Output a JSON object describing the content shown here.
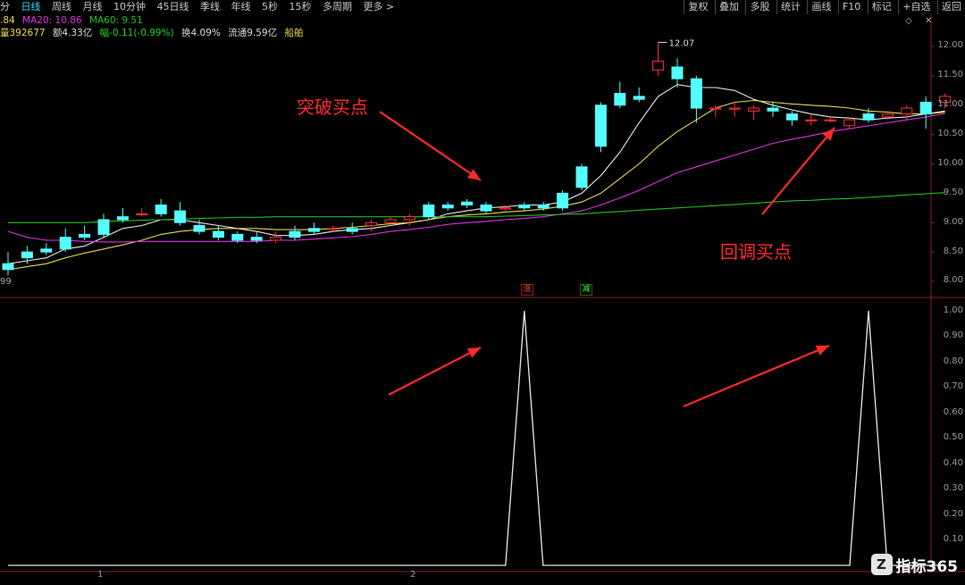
{
  "toolbar": {
    "left_fragment": "分",
    "periods": [
      "日线",
      "周线",
      "月线",
      "10分钟",
      "45日线",
      "季线",
      "年线",
      "5秒",
      "15秒",
      "多周期",
      "更多 >"
    ],
    "active_period": "日线",
    "right_tools": [
      "复权",
      "叠加",
      "多股",
      "统计",
      "画线",
      "F10",
      "标记",
      "+自选",
      "返回"
    ]
  },
  "ma_line": {
    "ma5": ".84",
    "ma20": "MA20: 10.86",
    "ma60": "MA60: 9.51"
  },
  "info_line": {
    "vol": "量392677",
    "amount": "额4.33亿",
    "change": "幅-0.11(-0.99%)",
    "turnover": "换4.09%",
    "float": "流通9.59亿",
    "sector": "船舶"
  },
  "price_axis": [
    "12.00",
    "11.50",
    "11.00",
    "10.50",
    "10.00",
    "9.50",
    "9.00",
    "8.50",
    "8.00"
  ],
  "indicator_axis": [
    "1.00",
    "0.90",
    "0.80",
    "0.70",
    "0.60",
    "0.50",
    "0.40",
    "0.30",
    "0.20",
    "0.10"
  ],
  "high_label": "12.07",
  "left_edge_fragment": "99",
  "markers": {
    "up": "涨",
    "down": "减"
  },
  "annotations": {
    "breakout": "突破买点",
    "pullback": "回调买点"
  },
  "time_axis_labels": [
    "1",
    "2"
  ],
  "colors": {
    "up": "#ff3030",
    "down": "#54ffff",
    "ma5": "#e8e8e8",
    "ma10": "#e6d84a",
    "ma20": "#e030e0",
    "ma60": "#1fbf1f",
    "annotation": "#ff2a2a"
  },
  "logo": {
    "icon": "Z",
    "text": "指标365"
  },
  "chart_data": {
    "type": "candlestick",
    "ylim": [
      7.9,
      12.2
    ],
    "candles": [
      [
        8.3,
        8.2,
        8.5,
        8.1
      ],
      [
        8.5,
        8.4,
        8.6,
        8.3
      ],
      [
        8.55,
        8.5,
        8.65,
        8.45
      ],
      [
        8.75,
        8.55,
        8.9,
        8.5
      ],
      [
        8.8,
        8.75,
        8.95,
        8.7
      ],
      [
        9.05,
        8.8,
        9.15,
        8.75
      ],
      [
        9.1,
        9.05,
        9.25,
        9.0
      ],
      [
        9.15,
        9.15,
        9.25,
        9.1
      ],
      [
        9.3,
        9.15,
        9.4,
        9.1
      ],
      [
        9.2,
        9.0,
        9.35,
        8.95
      ],
      [
        8.95,
        8.85,
        9.05,
        8.8
      ],
      [
        8.85,
        8.75,
        8.95,
        8.7
      ],
      [
        8.8,
        8.7,
        8.85,
        8.65
      ],
      [
        8.75,
        8.7,
        8.85,
        8.65
      ],
      [
        8.7,
        8.75,
        8.85,
        8.65
      ],
      [
        8.85,
        8.75,
        8.95,
        8.7
      ],
      [
        8.9,
        8.85,
        9.0,
        8.8
      ],
      [
        8.9,
        8.9,
        8.95,
        8.85
      ],
      [
        8.9,
        8.85,
        9.0,
        8.8
      ],
      [
        8.95,
        9.0,
        9.05,
        8.85
      ],
      [
        9.0,
        9.05,
        9.1,
        8.95
      ],
      [
        9.05,
        9.1,
        9.15,
        8.95
      ],
      [
        9.3,
        9.1,
        9.35,
        9.05
      ],
      [
        9.3,
        9.25,
        9.35,
        9.2
      ],
      [
        9.35,
        9.3,
        9.4,
        9.25
      ],
      [
        9.3,
        9.2,
        9.35,
        9.15
      ],
      [
        9.25,
        9.25,
        9.3,
        9.2
      ],
      [
        9.3,
        9.25,
        9.35,
        9.2
      ],
      [
        9.3,
        9.25,
        9.35,
        9.2
      ],
      [
        9.5,
        9.25,
        9.55,
        9.2
      ],
      [
        9.95,
        9.6,
        10.0,
        9.55
      ],
      [
        11.0,
        10.3,
        11.05,
        10.2
      ],
      [
        11.2,
        11.0,
        11.4,
        10.95
      ],
      [
        11.15,
        11.1,
        11.3,
        11.05
      ],
      [
        11.6,
        11.75,
        12.07,
        11.5
      ],
      [
        11.65,
        11.45,
        11.8,
        11.3
      ],
      [
        11.45,
        10.95,
        11.5,
        10.7
      ],
      [
        10.95,
        10.95,
        11.0,
        10.8
      ],
      [
        10.95,
        10.95,
        11.05,
        10.8
      ],
      [
        10.9,
        10.95,
        11.0,
        10.75
      ],
      [
        10.95,
        10.9,
        11.05,
        10.8
      ],
      [
        10.85,
        10.75,
        10.9,
        10.65
      ],
      [
        10.75,
        10.75,
        10.85,
        10.65
      ],
      [
        10.75,
        10.75,
        10.8,
        10.7
      ],
      [
        10.65,
        10.75,
        10.8,
        10.6
      ],
      [
        10.85,
        10.75,
        10.95,
        10.7
      ],
      [
        10.8,
        10.85,
        10.9,
        10.75
      ],
      [
        10.85,
        10.95,
        11.0,
        10.75
      ],
      [
        11.05,
        10.85,
        11.15,
        10.6
      ],
      [
        11.05,
        11.15,
        11.2,
        10.95
      ]
    ],
    "ma_series": [
      {
        "name": "MA5",
        "color": "#e8e8e8",
        "values": [
          8.3,
          8.35,
          8.4,
          8.55,
          8.6,
          8.75,
          8.9,
          8.95,
          9.05,
          9.05,
          9.0,
          8.95,
          8.9,
          8.85,
          8.78,
          8.78,
          8.8,
          8.85,
          8.88,
          8.9,
          8.95,
          9.0,
          9.05,
          9.15,
          9.2,
          9.25,
          9.27,
          9.3,
          9.3,
          9.35,
          9.5,
          9.8,
          10.2,
          10.7,
          11.15,
          11.35,
          11.3,
          11.3,
          11.25,
          11.1,
          11.0,
          10.92,
          10.85,
          10.8,
          10.78,
          10.75,
          10.78,
          10.8,
          10.85,
          10.9
        ]
      },
      {
        "name": "MA10",
        "color": "#e6d84a",
        "values": [
          8.2,
          8.25,
          8.3,
          8.4,
          8.48,
          8.55,
          8.62,
          8.7,
          8.8,
          8.85,
          8.88,
          8.9,
          8.9,
          8.9,
          8.88,
          8.88,
          8.88,
          8.9,
          8.92,
          8.95,
          8.98,
          9.0,
          9.05,
          9.1,
          9.13,
          9.15,
          9.18,
          9.2,
          9.23,
          9.28,
          9.35,
          9.5,
          9.75,
          10.0,
          10.3,
          10.55,
          10.75,
          10.95,
          11.05,
          11.08,
          11.05,
          11.02,
          11.0,
          10.98,
          10.95,
          10.9,
          10.88,
          10.85,
          10.85,
          10.88
        ]
      },
      {
        "name": "MA20",
        "color": "#e030e0",
        "values": [
          8.85,
          8.75,
          8.7,
          8.7,
          8.68,
          8.67,
          8.67,
          8.68,
          8.68,
          8.68,
          8.68,
          8.68,
          8.68,
          8.68,
          8.7,
          8.7,
          8.72,
          8.74,
          8.76,
          8.8,
          8.85,
          8.88,
          8.92,
          8.97,
          9.0,
          9.02,
          9.05,
          9.07,
          9.1,
          9.15,
          9.2,
          9.3,
          9.42,
          9.55,
          9.7,
          9.85,
          9.95,
          10.05,
          10.15,
          10.25,
          10.35,
          10.42,
          10.48,
          10.55,
          10.6,
          10.65,
          10.7,
          10.75,
          10.8,
          10.86
        ]
      },
      {
        "name": "MA60",
        "color": "#1fbf1f",
        "values": [
          9.0,
          9.0,
          9.0,
          9.0,
          9.0,
          9.02,
          9.03,
          9.04,
          9.05,
          9.06,
          9.07,
          9.08,
          9.09,
          9.09,
          9.1,
          9.1,
          9.1,
          9.1,
          9.1,
          9.1,
          9.1,
          9.1,
          9.1,
          9.1,
          9.1,
          9.1,
          9.11,
          9.12,
          9.13,
          9.14,
          9.15,
          9.17,
          9.19,
          9.21,
          9.23,
          9.25,
          9.27,
          9.29,
          9.31,
          9.33,
          9.35,
          9.37,
          9.38,
          9.4,
          9.41,
          9.43,
          9.45,
          9.47,
          9.49,
          9.51
        ]
      }
    ],
    "indicator": {
      "ylim": [
        0,
        1.0
      ],
      "values": [
        0,
        0,
        0,
        0,
        0,
        0,
        0,
        0,
        0,
        0,
        0,
        0,
        0,
        0,
        0,
        0,
        0,
        0,
        0,
        0,
        0,
        0,
        0,
        0,
        0,
        0,
        0,
        1.0,
        0,
        0,
        0,
        0,
        0,
        0,
        0,
        0,
        0,
        0,
        0,
        0,
        0,
        0,
        0,
        0,
        0,
        1.0,
        0,
        0,
        0,
        0
      ]
    }
  }
}
